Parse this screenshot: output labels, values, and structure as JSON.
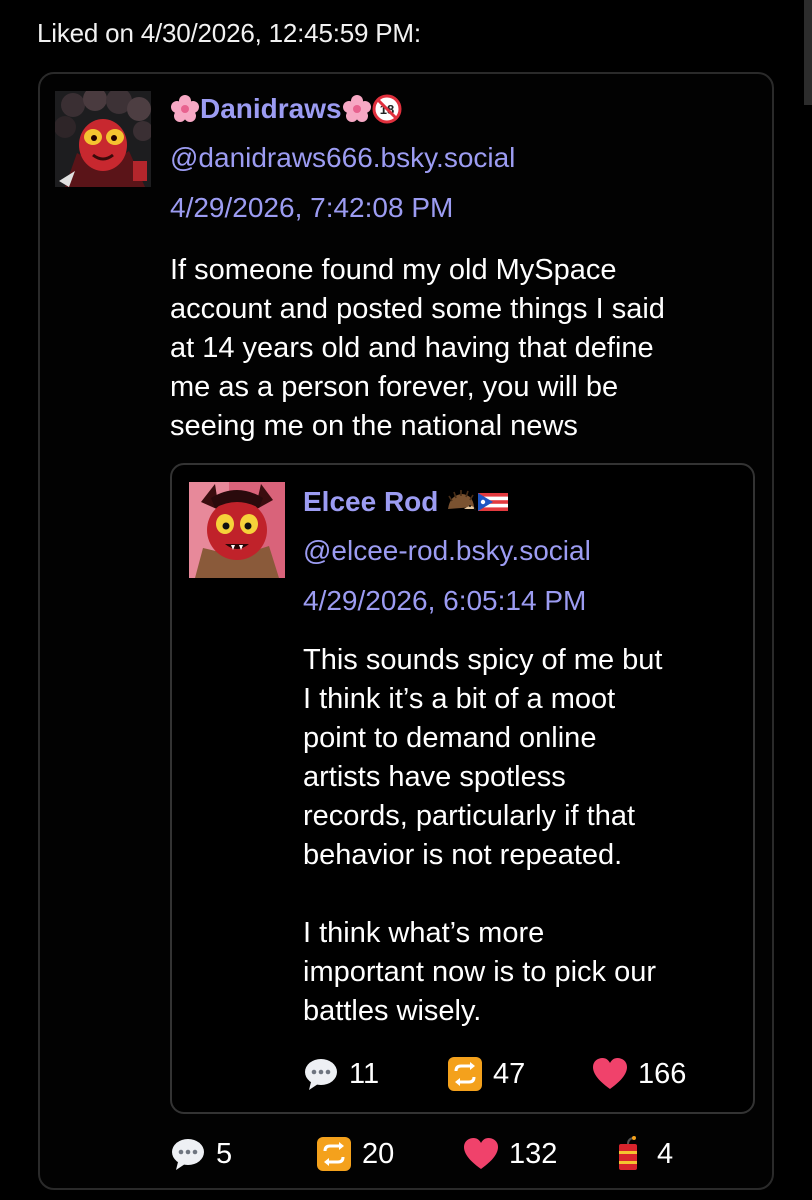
{
  "liked_header": "Liked on 4/30/2026, 12:45:59 PM:",
  "post": {
    "display_name": "Danidraws",
    "name_emojis": [
      "cherry-blossom-icon",
      "cherry-blossom-icon",
      "no-under-18-icon"
    ],
    "handle": "@danidraws666.bsky.social",
    "timestamp": "4/29/2026, 7:42:08 PM",
    "text_lines": [
      "If someone found my old MySpace",
      "account and posted some things I said",
      "at 14 years old and having that define",
      "me as a person forever, you will be",
      "seeing me on the national news"
    ],
    "stats": {
      "replies": "5",
      "reposts": "20",
      "likes": "132",
      "extra": "4"
    },
    "stat_icons": [
      "speech-bubble-icon",
      "repost-icon",
      "heart-icon",
      "firecracker-icon"
    ]
  },
  "quoted_post": {
    "display_name": "Elcee Rod",
    "name_emojis": [
      "hedgehog-icon",
      "puerto-rico-flag-icon"
    ],
    "handle": "@elcee-rod.bsky.social",
    "timestamp": "4/29/2026, 6:05:14 PM",
    "paragraph1": "This sounds spicy of me but\nI think it’s a bit of a moot\npoint to demand online\nartists have spotless\nrecords, particularly if that\nbehavior is not repeated.",
    "paragraph2": "I think what’s more\nimportant now is to pick our\nbattles wisely.",
    "stats": {
      "replies": "11",
      "reposts": "47",
      "likes": "166"
    }
  },
  "colors": {
    "background": "#000000",
    "link_text": "#9c9cf2",
    "body_text": "#ffffff",
    "card_border": "#2a2a2a",
    "heart": "#f0426b",
    "repost": "#f4a11c"
  }
}
